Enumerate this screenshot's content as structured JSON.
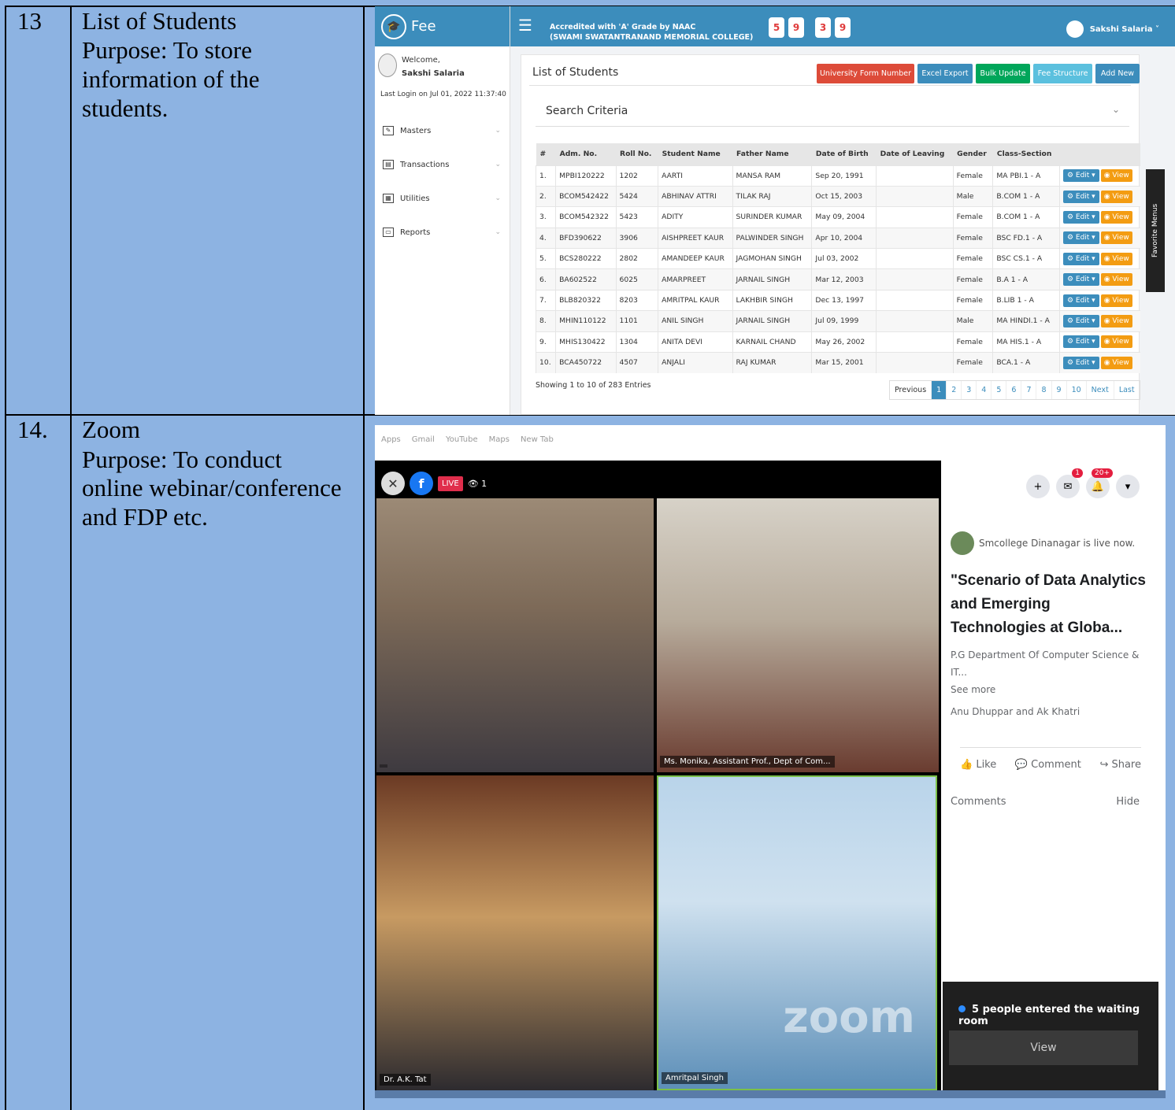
{
  "rows": [
    {
      "number": "13",
      "title": "List of Students",
      "purpose": [
        "Purpose: To store",
        "information of the",
        "students."
      ]
    },
    {
      "number": "14.",
      "title": "Zoom",
      "purpose": [
        "Purpose: To conduct",
        "online webinar/conference",
        "and FDP etc."
      ]
    }
  ],
  "fee_app": {
    "brand": "Fee",
    "welcome": "Welcome,",
    "user_name": "Sakshi Salaria",
    "last_login": "Last Login on Jul 01, 2022 11:37:40",
    "menu": [
      "Masters",
      "Transactions",
      "Utilities",
      "Reports"
    ],
    "accreditation_line1": "Accredited with 'A' Grade by NAAC",
    "accreditation_line2": "(SWAMI SWATANTRANAND MEMORIAL COLLEGE)",
    "counters": [
      "5",
      "9",
      "3",
      "9"
    ],
    "topbar_user": "Sakshi Salaria ˅",
    "panel_title": "List of Students",
    "buttons": [
      {
        "label": "University Form Number",
        "color": "#dd4b39"
      },
      {
        "label": "Excel Export",
        "color": "#3c8dbc"
      },
      {
        "label": "Bulk Update",
        "color": "#00a65a"
      },
      {
        "label": "Fee Structure",
        "color": "#5bc0de"
      },
      {
        "label": "Add New",
        "color": "#3c8dbc"
      }
    ],
    "search_criteria": "Search Criteria",
    "columns": [
      "#",
      "Adm. No.",
      "Roll No.",
      "Student Name",
      "Father Name",
      "Date of Birth",
      "Date of Leaving",
      "Gender",
      "Class-Section",
      ""
    ],
    "students": [
      [
        "1.",
        "MPBI120222",
        "1202",
        "AARTI",
        "MANSA RAM",
        "Sep 20, 1991",
        "",
        "Female",
        "MA PBI.1 - A"
      ],
      [
        "2.",
        "BCOM542422",
        "5424",
        "ABHINAV ATTRI",
        "TILAK RAJ",
        "Oct 15, 2003",
        "",
        "Male",
        "B.COM 1 - A"
      ],
      [
        "3.",
        "BCOM542322",
        "5423",
        "ADITY",
        "SURINDER KUMAR",
        "May 09, 2004",
        "",
        "Female",
        "B.COM 1 - A"
      ],
      [
        "4.",
        "BFD390622",
        "3906",
        "AISHPREET KAUR",
        "PALWINDER SINGH",
        "Apr 10, 2004",
        "",
        "Female",
        "BSC FD.1 - A"
      ],
      [
        "5.",
        "BCS280222",
        "2802",
        "AMANDEEP KAUR",
        "JAGMOHAN SINGH",
        "Jul 03, 2002",
        "",
        "Female",
        "BSC CS.1 - A"
      ],
      [
        "6.",
        "BA602522",
        "6025",
        "AMARPREET",
        "JARNAIL SINGH",
        "Mar 12, 2003",
        "",
        "Female",
        "B.A 1 - A"
      ],
      [
        "7.",
        "BLB820322",
        "8203",
        "AMRITPAL KAUR",
        "LAKHBIR SINGH",
        "Dec 13, 1997",
        "",
        "Female",
        "B.LIB 1 - A"
      ],
      [
        "8.",
        "MHIN110122",
        "1101",
        "ANIL SINGH",
        "JARNAIL SINGH",
        "Jul 09, 1999",
        "",
        "Male",
        "MA HINDI.1 - A"
      ],
      [
        "9.",
        "MHIS130422",
        "1304",
        "ANITA DEVI",
        "KARNAIL CHAND",
        "May 26, 2002",
        "",
        "Female",
        "MA HIS.1 - A"
      ],
      [
        "10.",
        "BCA450722",
        "4507",
        "ANJALI",
        "RAJ KUMAR",
        "Mar 15, 2001",
        "",
        "Female",
        "BCA.1 - A"
      ]
    ],
    "edit_label": "⚙ Edit ▾",
    "view_label": "◉ View",
    "showing": "Showing 1 to 10 of 283 Entries",
    "pager": [
      "Previous",
      "1",
      "2",
      "3",
      "4",
      "5",
      "6",
      "7",
      "8",
      "9",
      "10",
      "Next",
      "Last"
    ],
    "favorite_menus": "Favorite Menus"
  },
  "zoom_app": {
    "bookmarks": [
      "Apps",
      "Gmail",
      "YouTube",
      "Maps",
      "New Tab"
    ],
    "viewers": "1",
    "live": "LIVE",
    "participants": [
      "",
      "Ms. Monika, Assistant Prof., Dept of Com...",
      "Dr. A.K. Tat",
      "Amritpal Singh"
    ],
    "watermark": "zoom",
    "page_name": "Smcollege Dinanagar is live now.",
    "post_title": "\"Scenario of Data Analytics and Emerging Technologies at Globa...",
    "post_desc": "P.G Department Of Computer Science & IT...",
    "see_more": "See more",
    "reactors": "Anu Dhuppar and Ak Khatri",
    "actions": [
      "Like",
      "Comment",
      "Share"
    ],
    "comments_label": "Comments",
    "hide_label": "Hide",
    "badges": [
      "1",
      "20+"
    ],
    "waiting_room": "5 people entered the waiting room",
    "view_btn": "View"
  }
}
